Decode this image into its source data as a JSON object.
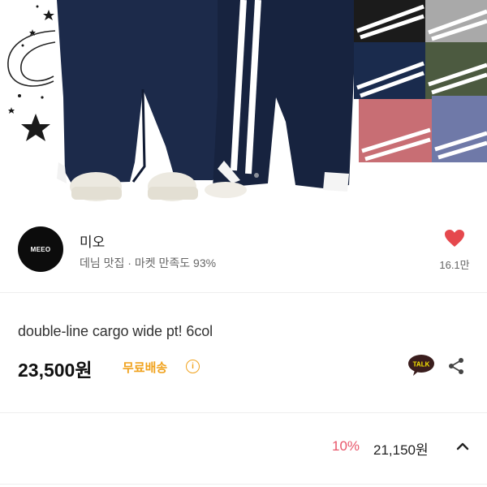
{
  "seller": {
    "avatar_text": "MEEO",
    "name": "미오",
    "description": "데님 맛집 · 마켓 만족도 93%",
    "likes": "16.1만"
  },
  "product": {
    "title": "double-line cargo wide pt! 6col",
    "price": "23,500원",
    "shipping_badge": "무료배송",
    "info_icon": "i"
  },
  "purchase_bar": {
    "discount": "10%",
    "final_price": "21,150원"
  },
  "colors": {
    "heart": "#e5484d",
    "shipping": "#f0a21d",
    "discount": "#e8566a",
    "talk_badge": "#3a1d1d"
  },
  "icons": [
    "star-icon",
    "heart-icon",
    "info-icon",
    "kakao-talk-icon",
    "share-icon",
    "chevron-up-icon"
  ]
}
